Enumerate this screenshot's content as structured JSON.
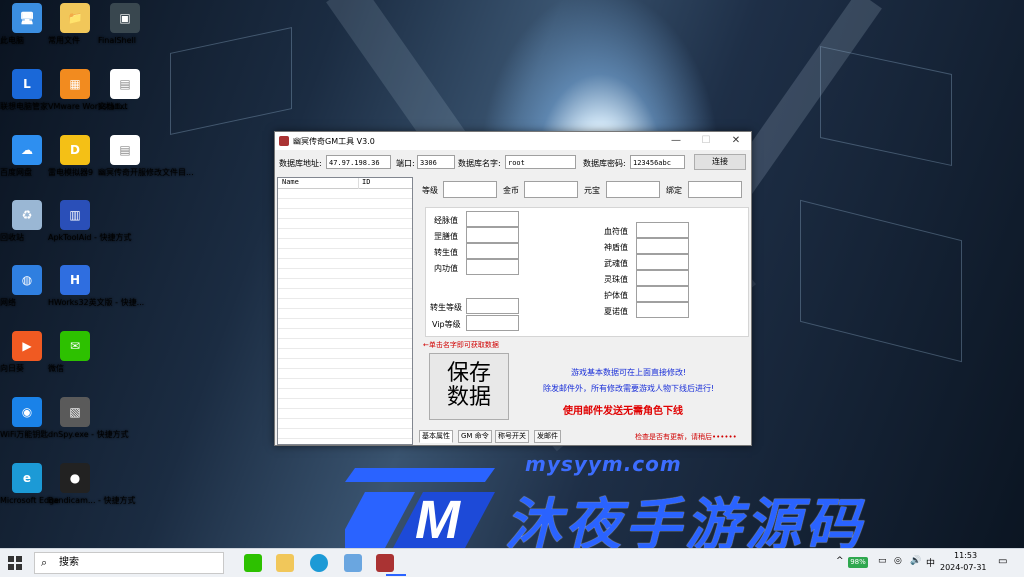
{
  "desktop": {
    "icons": [
      {
        "label": "此电脑",
        "color": "#3b8ee0",
        "glyph": "🖥"
      },
      {
        "label": "常用文件",
        "color": "#f1c75a",
        "glyph": "📁"
      },
      {
        "label": "FinalShell",
        "color": "#39474f",
        "glyph": "▣"
      },
      {
        "label": "联想电脑管家",
        "color": "#1a68d8",
        "glyph": "L"
      },
      {
        "label": "VMware Workstati...",
        "color": "#f28b1f",
        "glyph": "▦"
      },
      {
        "label": "文档.txt",
        "color": "#ffffff",
        "glyph": "▤"
      },
      {
        "label": "百度网盘",
        "color": "#2e8ff0",
        "glyph": "☁"
      },
      {
        "label": "雷电模拟器9",
        "color": "#f4c016",
        "glyph": "D"
      },
      {
        "label": "幽冥传奇开服修改文件目...",
        "color": "#ffffff",
        "glyph": "▤"
      },
      {
        "label": "回收站",
        "color": "#9ab7d4",
        "glyph": "♻"
      },
      {
        "label": "ApkToolAid - 快捷方式",
        "color": "#2a4fb8",
        "glyph": "▥"
      },
      {
        "label": "网络",
        "color": "#2f7fe0",
        "glyph": "◍"
      },
      {
        "label": "HWorks32英文版 - 快捷...",
        "color": "#2f6ee0",
        "glyph": "H"
      },
      {
        "label": "向日葵",
        "color": "#f05a22",
        "glyph": "▶"
      },
      {
        "label": "微信",
        "color": "#2dc100",
        "glyph": "✉"
      },
      {
        "label": "WiFi万能钥匙",
        "color": "#1a82e8",
        "glyph": "◉"
      },
      {
        "label": "dnSpy.exe - 快捷方式",
        "color": "#5a5a5a",
        "glyph": "▧"
      },
      {
        "label": "Microsoft Edge",
        "color": "#1c9ad6",
        "glyph": "e"
      },
      {
        "label": "Bandicam... - 快捷方式",
        "color": "#222222",
        "glyph": "●"
      }
    ]
  },
  "window": {
    "title": "幽冥传奇GM工具 V3.0",
    "minimize": "—",
    "maximize": "☐",
    "close": "✕",
    "db_host_label": "数据库地址:",
    "db_host_value": "47.97.198.36",
    "port_label": "端口:",
    "port_value": "3306",
    "db_name_label": "数据库名字:",
    "db_name_value": "root",
    "db_pass_label": "数据库密码:",
    "db_pass_value": "123456abc",
    "connect_button": "连接",
    "list_col_name": "Name",
    "list_col_id": "ID",
    "level_label": "等级",
    "gold_label": "金币",
    "yuanbao_label": "元宝",
    "bind_label": "绑定",
    "exp_label": "经脉值",
    "guild_label": "罡膳值",
    "rebirth_label": "转生值",
    "inner_label": "内功值",
    "rebirth_level_label": "转生等级",
    "vip_label": "Vip等级",
    "blood_label": "血符值",
    "shield_label": "神盾值",
    "soul_label": "武魂值",
    "spirit_label": "灵珠值",
    "guard_label": "护体值",
    "jade_label": "夏诺值",
    "hint_arrow": "←单击名字即可获取数据",
    "save_button": "保存\n数据",
    "info1": "游戏基本数据可在上面直接修改!",
    "info2": "除发邮件外，所有修改需要游戏人物下线后进行!",
    "info3": "使用邮件发送无需角色下线",
    "update_hint": "检查是否有更新，请稍后••••••",
    "tabs": [
      "基本属性",
      "GM 命令",
      "称号开关",
      "发邮件"
    ]
  },
  "watermark": {
    "url": "mysyym.com",
    "text": "沐夜手游源码"
  },
  "taskbar": {
    "search_placeholder": "搜索",
    "battery": "98%",
    "time": "11:53",
    "date": "2024-07-31"
  }
}
